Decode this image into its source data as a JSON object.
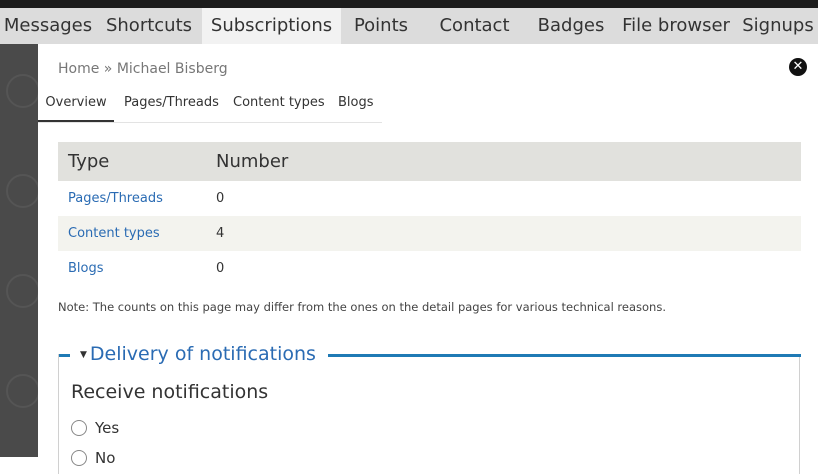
{
  "tabs": [
    {
      "label": "Messages",
      "active": false
    },
    {
      "label": "Shortcuts",
      "active": false
    },
    {
      "label": "Subscriptions",
      "active": true
    },
    {
      "label": "Points",
      "active": false
    },
    {
      "label": "Contact",
      "active": false
    },
    {
      "label": "Badges",
      "active": false
    },
    {
      "label": "File browser",
      "active": false
    },
    {
      "label": "Signups",
      "active": false
    }
  ],
  "breadcrumb": {
    "home": "Home",
    "separator": "»",
    "current": "Michael Bisberg"
  },
  "close_icon": "close-icon",
  "subtabs": [
    {
      "label": "Overview",
      "active": true
    },
    {
      "label": "Pages/Threads",
      "active": false
    },
    {
      "label": "Content types",
      "active": false
    },
    {
      "label": "Blogs",
      "active": false
    }
  ],
  "table": {
    "headers": [
      "Type",
      "Number"
    ],
    "rows": [
      {
        "type": "Pages/Threads",
        "number": "0"
      },
      {
        "type": "Content types",
        "number": "4"
      },
      {
        "type": "Blogs",
        "number": "0"
      }
    ]
  },
  "note": "Note: The counts on this page may differ from the ones on the detail pages for various technical reasons.",
  "delivery": {
    "legend": "Delivery of notifications",
    "title": "Receive notifications",
    "options": [
      "Yes",
      "No"
    ]
  },
  "colors": {
    "link": "#2a6bb3",
    "accent": "#1f7ab5",
    "header_bg": "#e1e1dd",
    "tabbar_bg": "#dcdcdc"
  }
}
